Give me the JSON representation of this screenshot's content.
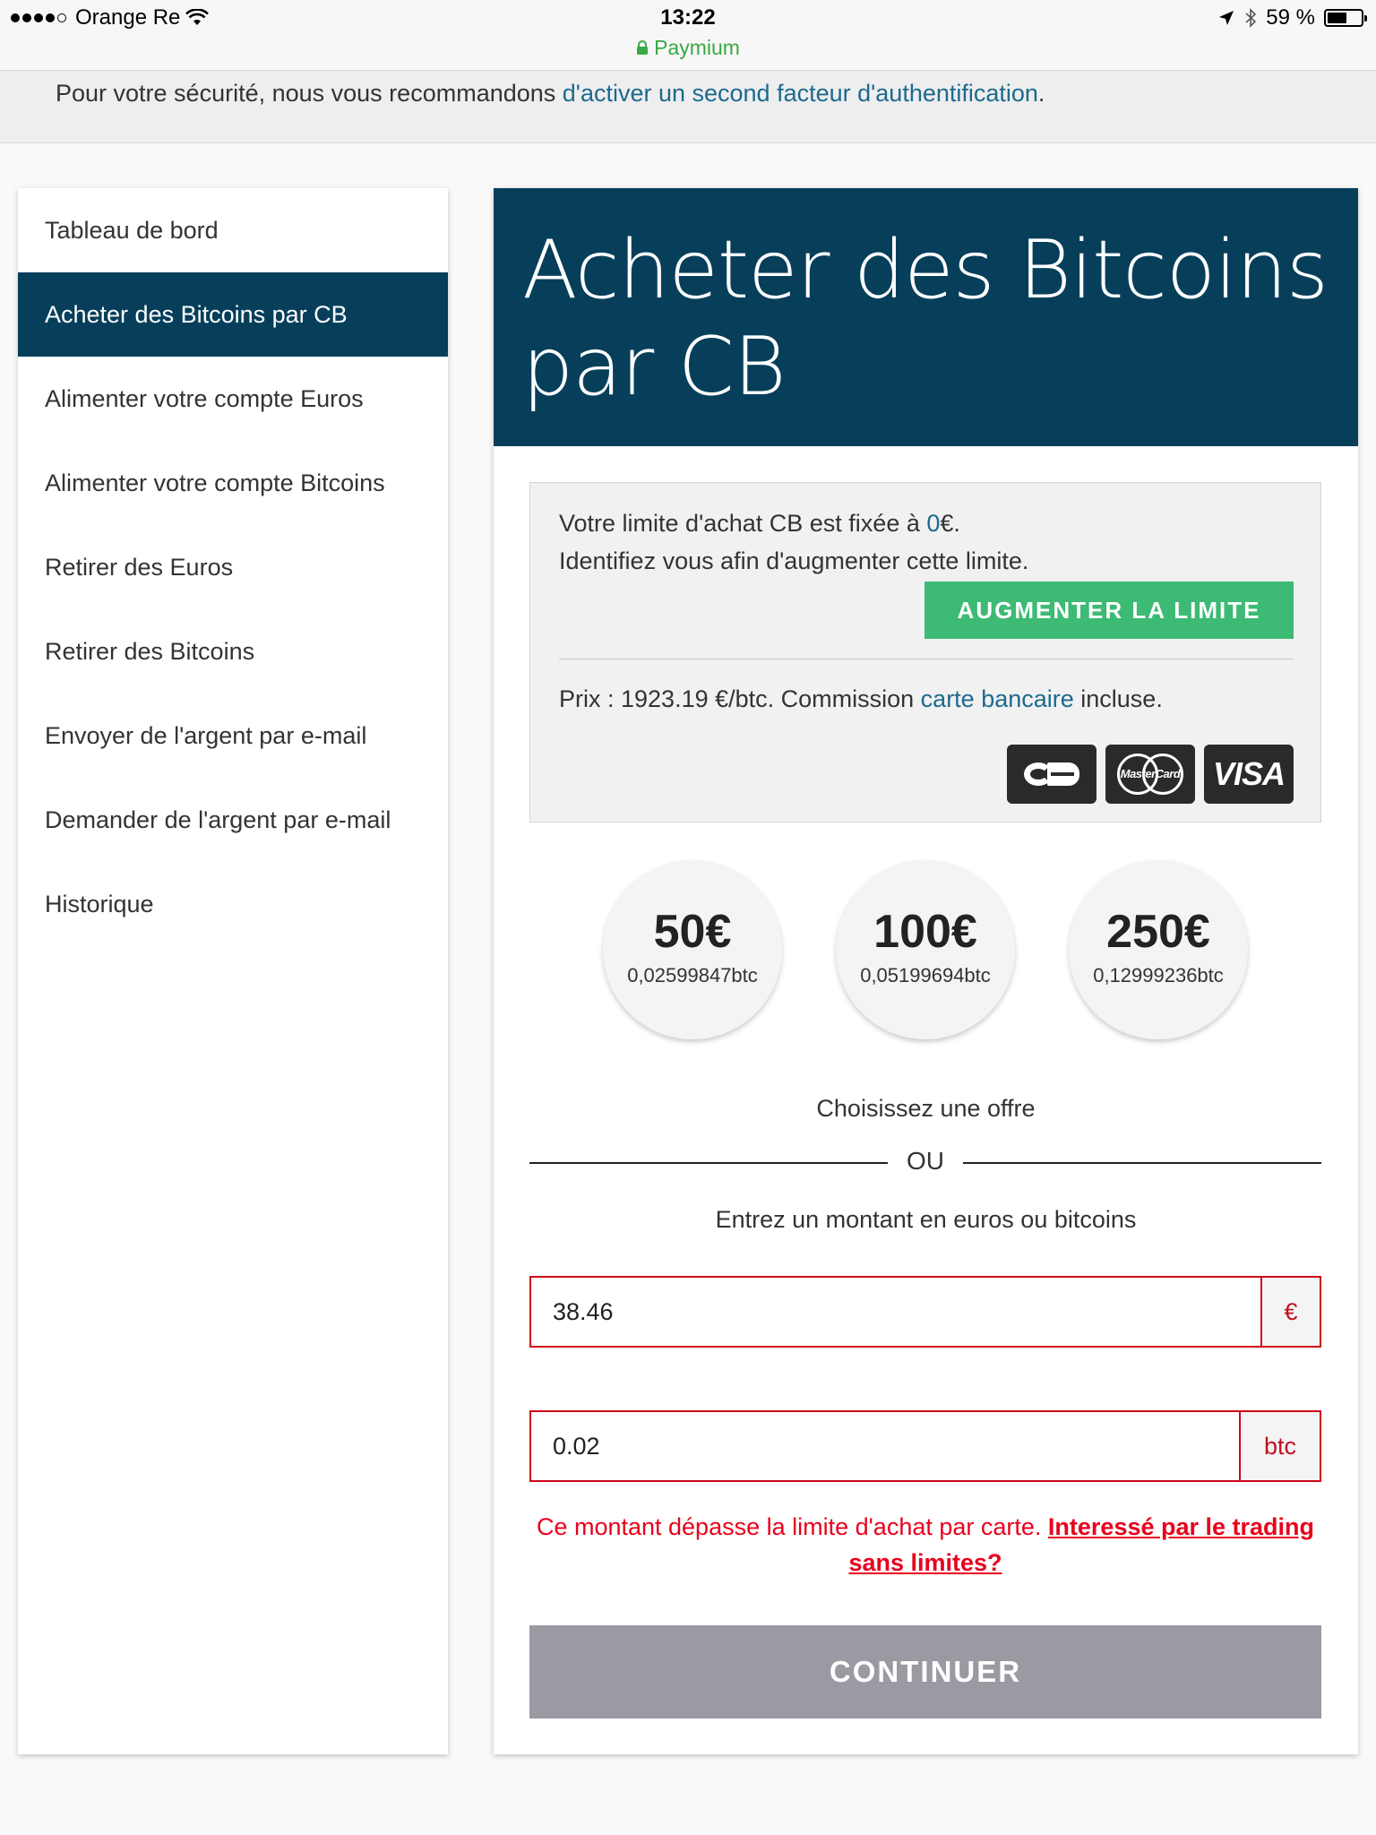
{
  "status_bar": {
    "carrier": "Orange Re",
    "time": "13:22",
    "url": "Paymium",
    "battery": "59 %",
    "battery_level": 0.59
  },
  "notice": {
    "text": "Pour votre sécurité, nous vous recommandons ",
    "link": "d'activer un second facteur d'authentification",
    "suffix": "."
  },
  "sidebar": {
    "items": [
      {
        "label": "Tableau de bord"
      },
      {
        "label": "Acheter des Bitcoins par CB"
      },
      {
        "label": "Alimenter votre compte Euros"
      },
      {
        "label": "Alimenter votre compte Bitcoins"
      },
      {
        "label": "Retirer des Euros"
      },
      {
        "label": "Retirer des Bitcoins"
      },
      {
        "label": "Envoyer de l'argent par e-mail"
      },
      {
        "label": "Demander de l'argent par e-mail"
      },
      {
        "label": "Historique"
      }
    ],
    "active_index": 1
  },
  "main": {
    "title": "Acheter des Bitcoins par CB",
    "info": {
      "limit_prefix": "Votre limite d'achat CB est fixée à ",
      "limit_value": "0",
      "limit_suffix": "€.",
      "identify": "Identifiez vous afin d'augmenter cette limite.",
      "button": "AUGMENTER LA LIMITE",
      "price_prefix": "Prix : 1923.19 €/btc. Commission ",
      "price_link": "carte bancaire",
      "price_suffix": " incluse.",
      "cards": {
        "mastercard": "MasterCard",
        "visa": "VISA"
      }
    },
    "offers": [
      {
        "amount": "50€",
        "btc": "0,02599847btc"
      },
      {
        "amount": "100€",
        "btc": "0,05199694btc"
      },
      {
        "amount": "250€",
        "btc": "0,12999236btc"
      }
    ],
    "choose_text": "Choisissez une offre",
    "or_text": "OU",
    "enter_text": "Entrez un montant en euros ou bitcoins",
    "euro_field": {
      "value": "38.46",
      "unit": "€"
    },
    "btc_field": {
      "value": "0.02",
      "unit": "btc"
    },
    "error": {
      "text": "Ce montant dépasse la limite d'achat par carte. ",
      "link": "Interessé par le trading sans limites?"
    },
    "continue": "CONTINUER"
  }
}
